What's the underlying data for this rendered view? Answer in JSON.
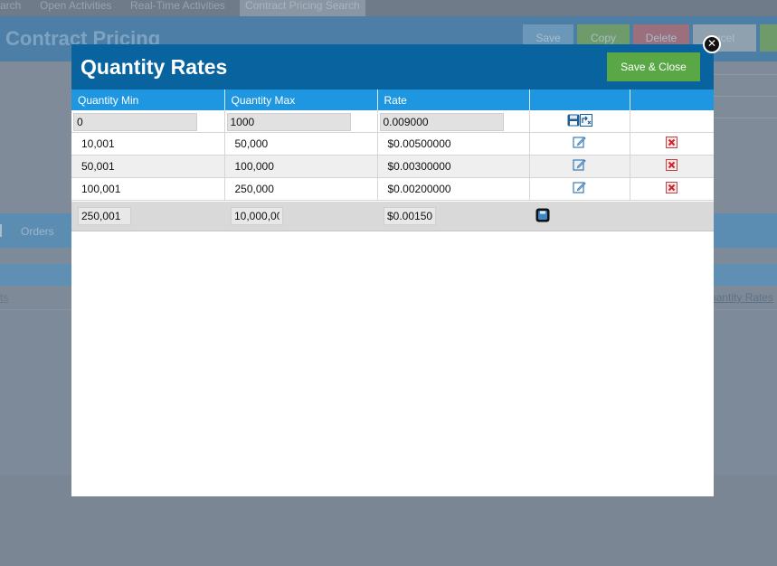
{
  "background": {
    "tabs": [
      "arch",
      "Open Activities",
      "Real-Time Activities",
      "Contract Pricing Search"
    ],
    "title": "Contract Pricing",
    "buttons": {
      "save": "Save",
      "copy": "Copy",
      "delete": "Delete",
      "cancel": "ncel"
    },
    "nav": {
      "orders": "Orders"
    },
    "links": {
      "left": "ts",
      "right": "uantity Rates"
    }
  },
  "modal": {
    "title": "Quantity Rates",
    "save_close": "Save & Close",
    "columns": [
      "Quantity Min",
      "Quantity Max",
      "Rate",
      "",
      ""
    ],
    "new_row": {
      "min": "0",
      "max": "1000",
      "rate": "0.009000"
    },
    "rows": [
      {
        "min": "10,001",
        "max": "50,000",
        "rate": "$0.00500000"
      },
      {
        "min": "50,001",
        "max": "100,000",
        "rate": "$0.00300000"
      },
      {
        "min": "100,001",
        "max": "250,000",
        "rate": "$0.00200000"
      }
    ],
    "last_row": {
      "min": "250,001",
      "max": "10,000,00",
      "rate": "$0.00150"
    }
  },
  "icons": {
    "save": "save-icon",
    "cancel": "cancel-icon",
    "edit": "edit-icon",
    "delete": "delete-icon",
    "close": "close-icon"
  },
  "colors": {
    "header": "#08639f",
    "table_header": "#1f96e0",
    "save_close": "#5aa845",
    "delete": "#c8262c"
  }
}
